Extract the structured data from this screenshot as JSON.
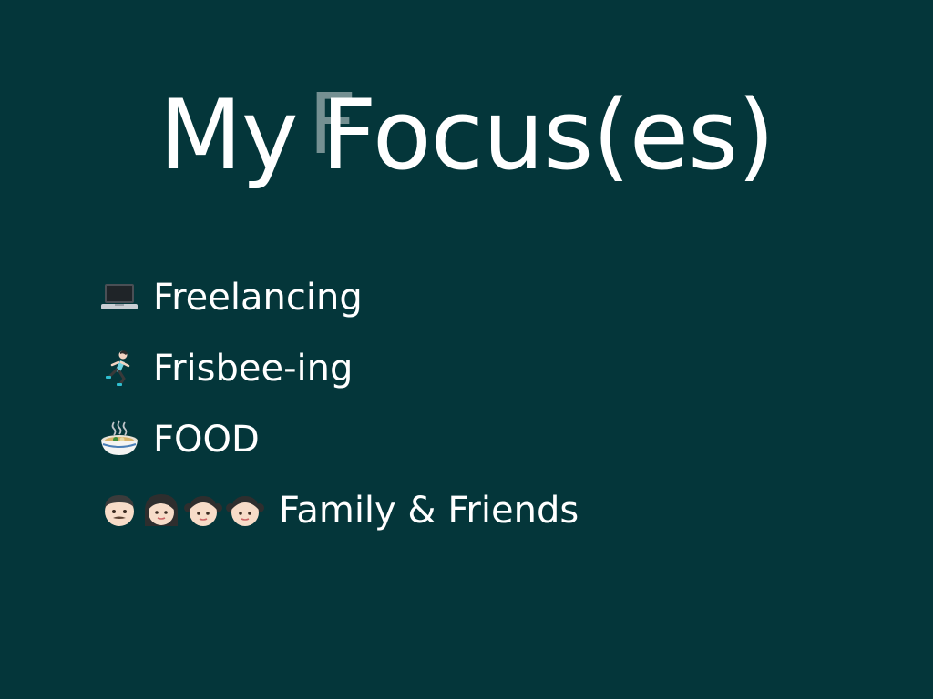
{
  "slide": {
    "title": {
      "my": "My",
      "ghost_letter": "F",
      "focus": "Focus(es)"
    },
    "items": [
      {
        "icon": "laptop-icon",
        "label": "Freelancing"
      },
      {
        "icon": "running-woman-icon",
        "label": "Frisbee-ing"
      },
      {
        "icon": "steaming-bowl-icon",
        "label": "FOOD"
      },
      {
        "icon": "family-faces-icon",
        "label": "Family & Friends"
      }
    ],
    "colors": {
      "background": "#04363A",
      "text": "#FFFFFF",
      "ghost_letter": "#8AA2A4"
    }
  }
}
